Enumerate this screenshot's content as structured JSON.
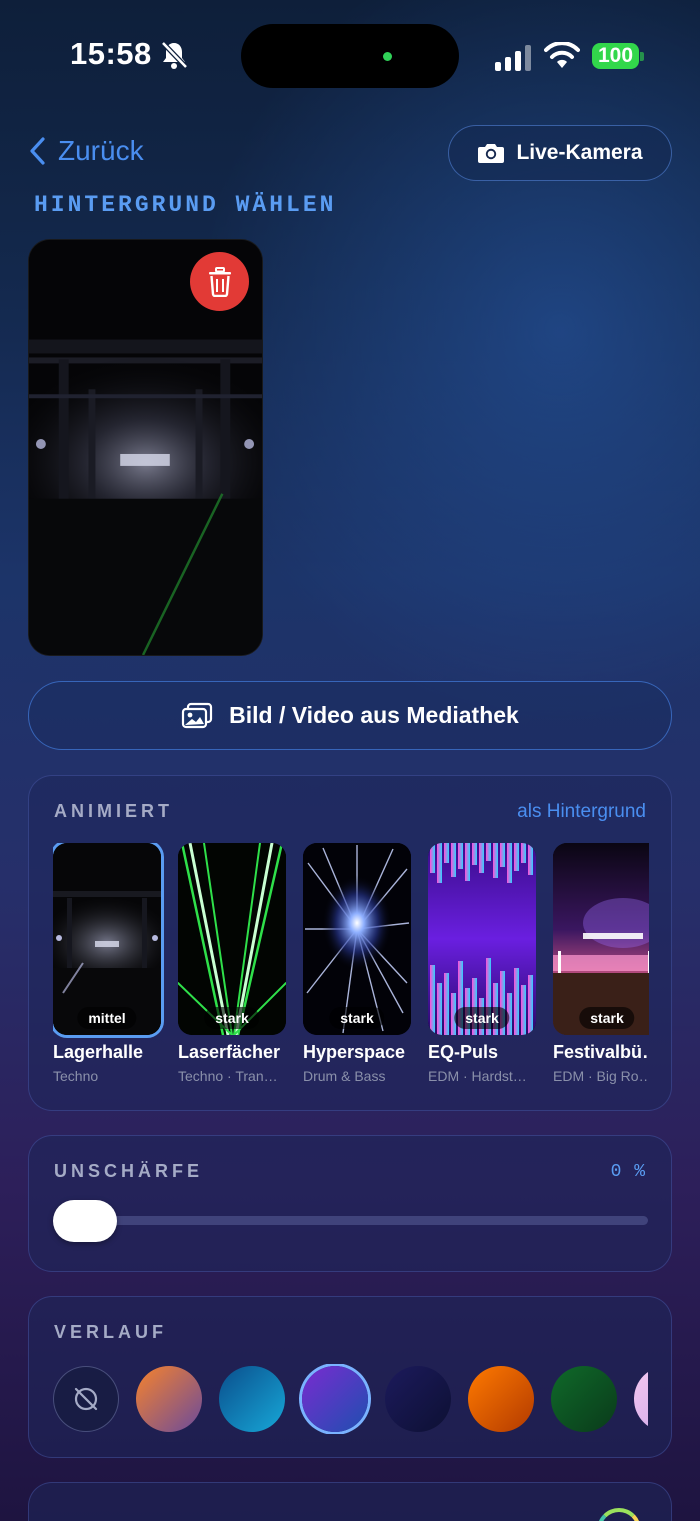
{
  "status": {
    "time": "15:58",
    "battery": "100",
    "icons": [
      "bell-slash-icon",
      "signal-icon",
      "wifi-icon",
      "battery-icon"
    ]
  },
  "nav": {
    "back_label": "Zurück",
    "live_camera_label": "Live-Kamera"
  },
  "background": {
    "heading": "HINTERGRUND WÄHLEN",
    "media_button_label": "Bild / Video aus Mediathek"
  },
  "animated": {
    "title": "ANIMIERT",
    "link": "als Hintergrund",
    "items": [
      {
        "name": "Lagerhalle",
        "genre": "Techno",
        "intensity": "mittel",
        "selected": true
      },
      {
        "name": "Laserfächer",
        "genre": "Techno · Tran…",
        "intensity": "stark"
      },
      {
        "name": "Hyperspace",
        "genre": "Drum & Bass",
        "intensity": "stark"
      },
      {
        "name": "EQ-Puls",
        "genre": "EDM · Hardst…",
        "intensity": "stark"
      },
      {
        "name": "Festivalbü…",
        "genre": "EDM · Big Ro…",
        "intensity": "stark"
      }
    ]
  },
  "blur": {
    "title": "UNSCHÄRFE",
    "value": "0 %",
    "level": 0
  },
  "gradient": {
    "title": "VERLAUF",
    "options": [
      {
        "id": "none",
        "colors": []
      },
      {
        "id": "sunset",
        "colors": [
          "#f7832c",
          "#6a4a9c"
        ]
      },
      {
        "id": "ocean",
        "colors": [
          "#0a4e8c",
          "#17a8d8"
        ]
      },
      {
        "id": "violet",
        "colors": [
          "#7a2bd0",
          "#1e4fb0"
        ],
        "selected": true
      },
      {
        "id": "midnight",
        "colors": [
          "#1c1a5c",
          "#0d1033"
        ]
      },
      {
        "id": "fire",
        "colors": [
          "#ff7a00",
          "#b23a00"
        ]
      },
      {
        "id": "forest",
        "colors": [
          "#0f6a2a",
          "#0a3a1a"
        ]
      },
      {
        "id": "rose",
        "colors": [
          "#f5c8f0",
          "#c7a2e8"
        ]
      }
    ]
  }
}
